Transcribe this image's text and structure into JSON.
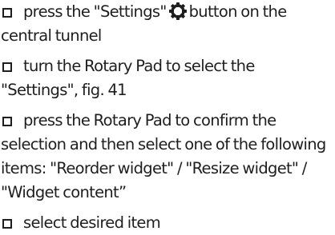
{
  "steps": [
    {
      "before_icon": "press the \"Settings\"",
      "icon": "gear-icon",
      "after_icon": "button on the central tunnel"
    },
    {
      "text": "turn the Rotary Pad to select the \"Settings\", fig. 41"
    },
    {
      "text": "press the Rotary Pad to confirm the selection and then select one of the following items: \"Reorder widget\" / \"Resize widget\" / \"Widget content”"
    },
    {
      "text": "select desired item"
    }
  ]
}
